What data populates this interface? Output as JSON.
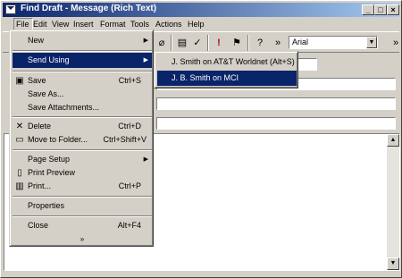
{
  "window": {
    "title": "Find Draft - Message (Rich Text)",
    "minimize": "_",
    "maximize": "□",
    "close": "×"
  },
  "menubar": [
    {
      "label": "File",
      "active": true
    },
    {
      "label": "Edit"
    },
    {
      "label": "View"
    },
    {
      "label": "Insert"
    },
    {
      "label": "Format"
    },
    {
      "label": "Tools"
    },
    {
      "label": "Actions"
    },
    {
      "label": "Help"
    }
  ],
  "toolbar": {
    "font": "Arial",
    "overflow": "»"
  },
  "file_menu": {
    "items": [
      {
        "label": "New",
        "submenu": true
      },
      {
        "separator": true
      },
      {
        "label": "Send Using",
        "submenu": true,
        "selected": true
      },
      {
        "separator": true
      },
      {
        "label": "Save",
        "shortcut": "Ctrl+S",
        "icon": "save-icon"
      },
      {
        "label": "Save As..."
      },
      {
        "label": "Save Attachments..."
      },
      {
        "separator": true
      },
      {
        "label": "Delete",
        "shortcut": "Ctrl+D",
        "icon": "delete-icon"
      },
      {
        "label": "Move to Folder...",
        "shortcut": "Ctrl+Shift+V",
        "icon": "move-folder-icon"
      },
      {
        "separator": true
      },
      {
        "label": "Page Setup",
        "submenu": true
      },
      {
        "label": "Print Preview",
        "icon": "print-preview-icon"
      },
      {
        "label": "Print...",
        "shortcut": "Ctrl+P",
        "icon": "print-icon"
      },
      {
        "separator": true
      },
      {
        "label": "Properties"
      },
      {
        "separator": true
      },
      {
        "label": "Close",
        "shortcut": "Alt+F4"
      }
    ],
    "more": "»"
  },
  "send_using_menu": {
    "items": [
      {
        "label": "J. Smith on AT&T Worldnet (Alt+S)"
      },
      {
        "label": "J. B. Smith on MCI",
        "selected": true
      }
    ]
  },
  "colors": {
    "title_start": "#0a246a",
    "title_end": "#a6caf0",
    "highlight": "#0a246a",
    "face": "#d4d0c8"
  }
}
